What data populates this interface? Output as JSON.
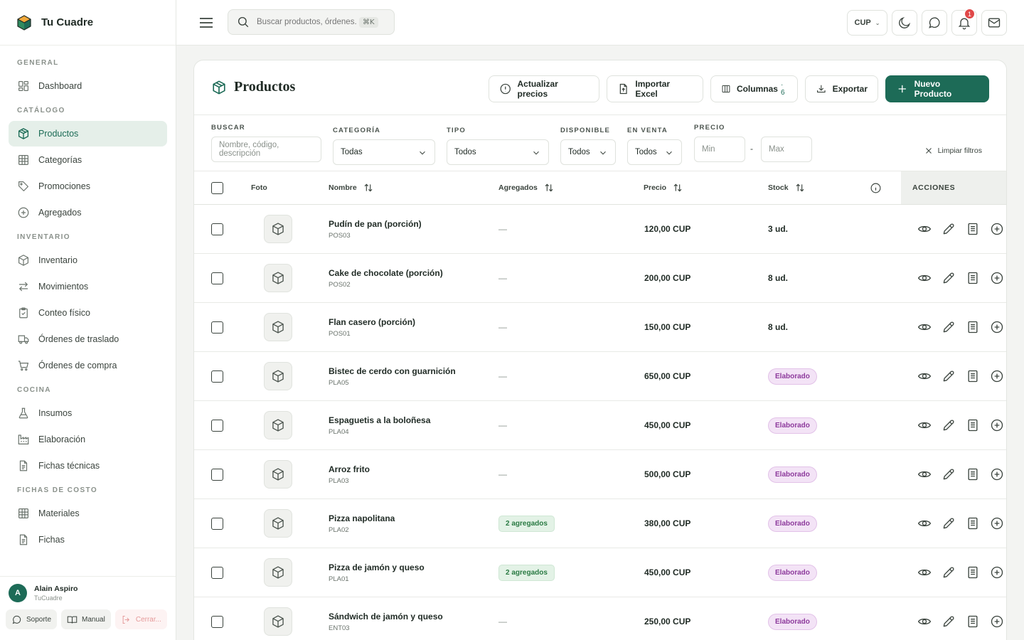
{
  "app": {
    "name": "Tu Cuadre"
  },
  "sidebar": {
    "sections": [
      {
        "label": "GENERAL",
        "items": [
          {
            "label": "Dashboard",
            "icon": "dashboard-icon"
          }
        ]
      },
      {
        "label": "CATÁLOGO",
        "items": [
          {
            "label": "Productos",
            "icon": "package-icon",
            "active": true
          },
          {
            "label": "Categorías",
            "icon": "grid-icon"
          },
          {
            "label": "Promociones",
            "icon": "tag-icon"
          },
          {
            "label": "Agregados",
            "icon": "plus-circle-icon"
          }
        ]
      },
      {
        "label": "INVENTARIO",
        "items": [
          {
            "label": "Inventario",
            "icon": "box-icon"
          },
          {
            "label": "Movimientos",
            "icon": "arrows-icon"
          },
          {
            "label": "Conteo físico",
            "icon": "clipboard-icon"
          },
          {
            "label": "Órdenes de traslado",
            "icon": "truck-icon"
          },
          {
            "label": "Órdenes de compra",
            "icon": "cart-icon"
          }
        ]
      },
      {
        "label": "COCINA",
        "items": [
          {
            "label": "Insumos",
            "icon": "flask-icon"
          },
          {
            "label": "Elaboración",
            "icon": "factory-icon"
          },
          {
            "label": "Fichas técnicas",
            "icon": "document-icon"
          }
        ]
      },
      {
        "label": "FICHAS DE COSTO",
        "items": [
          {
            "label": "Materiales",
            "icon": "grid-icon"
          },
          {
            "label": "Fichas",
            "icon": "document-icon"
          }
        ]
      }
    ],
    "user": {
      "initial": "A",
      "name": "Alain Aspiro",
      "org": "TuCuadre"
    },
    "footer": {
      "support": "Soporte",
      "manual": "Manual",
      "logout": "Cerrar..."
    }
  },
  "header": {
    "search_placeholder": "Buscar productos, órdenes...",
    "shortcut": "⌘K",
    "currency": "CUP",
    "notifications": "1"
  },
  "page": {
    "title": "Productos",
    "buttons": {
      "update_prices": "Actualizar precios",
      "import_excel": "Importar Excel",
      "columns": "Columnas",
      "columns_count": "· 6",
      "export": "Exportar",
      "new_product": "Nuevo Producto"
    }
  },
  "filters": {
    "search_label": "BUSCAR",
    "search_placeholder": "Nombre, código, descripción",
    "category_label": "CATEGORÍA",
    "category_value": "Todas",
    "type_label": "TIPO",
    "type_value": "Todos",
    "available_label": "DISPONIBLE",
    "available_value": "Todos",
    "onsale_label": "EN VENTA",
    "onsale_value": "Todos",
    "price_label": "PRECIO",
    "price_min": "Min",
    "price_sep": "-",
    "price_max": "Max",
    "clear": "Limpiar filtros"
  },
  "table": {
    "headers": {
      "photo": "Foto",
      "name": "Nombre",
      "added": "Agregados",
      "price": "Precio",
      "stock": "Stock",
      "actions": "ACCIONES"
    },
    "rows": [
      {
        "name": "Pudín de pan (porción)",
        "code": "POS03",
        "added": "—",
        "added_badge": false,
        "price": "120,00 CUP",
        "stock": "3 ud.",
        "stock_badge": false
      },
      {
        "name": "Cake de chocolate (porción)",
        "code": "POS02",
        "added": "—",
        "added_badge": false,
        "price": "200,00 CUP",
        "stock": "8 ud.",
        "stock_badge": false
      },
      {
        "name": "Flan casero (porción)",
        "code": "POS01",
        "added": "—",
        "added_badge": false,
        "price": "150,00 CUP",
        "stock": "8 ud.",
        "stock_badge": false
      },
      {
        "name": "Bistec de cerdo con guarnición",
        "code": "PLA05",
        "added": "—",
        "added_badge": false,
        "price": "650,00 CUP",
        "stock": "Elaborado",
        "stock_badge": true
      },
      {
        "name": "Espaguetis a la boloñesa",
        "code": "PLA04",
        "added": "—",
        "added_badge": false,
        "price": "450,00 CUP",
        "stock": "Elaborado",
        "stock_badge": true
      },
      {
        "name": "Arroz frito",
        "code": "PLA03",
        "added": "—",
        "added_badge": false,
        "price": "500,00 CUP",
        "stock": "Elaborado",
        "stock_badge": true
      },
      {
        "name": "Pizza napolitana",
        "code": "PLA02",
        "added": "2 agregados",
        "added_badge": true,
        "price": "380,00 CUP",
        "stock": "Elaborado",
        "stock_badge": true
      },
      {
        "name": "Pizza de jamón y queso",
        "code": "PLA01",
        "added": "2 agregados",
        "added_badge": true,
        "price": "450,00 CUP",
        "stock": "Elaborado",
        "stock_badge": true
      },
      {
        "name": "Sándwich de jamón y queso",
        "code": "ENT03",
        "added": "—",
        "added_badge": false,
        "price": "250,00 CUP",
        "stock": "Elaborado",
        "stock_badge": true
      }
    ]
  }
}
